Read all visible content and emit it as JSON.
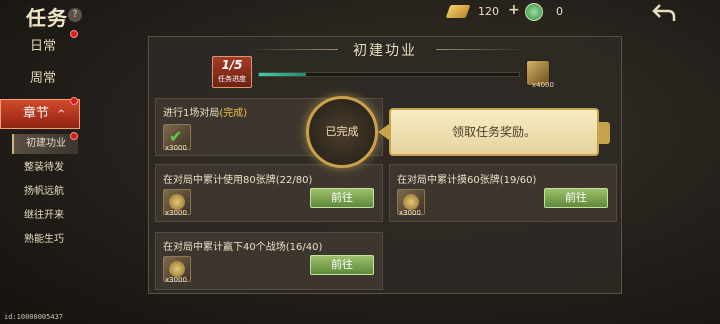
{
  "header": {
    "title": "任务",
    "help": "?",
    "gold_amount": "120",
    "plus": "+",
    "jade_amount": "0",
    "back_icon": "back-arrow-icon"
  },
  "sidebar": {
    "items": [
      {
        "label": "日常",
        "has_dot": true
      },
      {
        "label": "周常",
        "has_dot": false
      }
    ],
    "active": {
      "label": "章节",
      "chevron": "^",
      "has_dot": true
    },
    "subitems": [
      {
        "label": "初建功业",
        "active": true,
        "has_dot": true
      },
      {
        "label": "整装待发"
      },
      {
        "label": "扬帆远航"
      },
      {
        "label": "继往开来"
      },
      {
        "label": "熟能生巧"
      }
    ]
  },
  "panel": {
    "title": "初建功业",
    "progress": {
      "value": "1/5",
      "label": "任务进度",
      "fraction": 0.18
    },
    "chest_amount": "x4000"
  },
  "tasks": [
    {
      "title": "进行1场对局",
      "status": "(完成)",
      "reward": "x3000",
      "completed": true
    },
    {
      "title": "在对局中累计使用80张牌(22/80)",
      "reward": "x3000",
      "button": "前往"
    },
    {
      "title": "在对局中累计摸60张牌(19/60)",
      "reward": "x3000",
      "button": "前往"
    },
    {
      "title": "在对局中累计赢下40个战场(16/40)",
      "reward": "x3000",
      "button": "前往"
    }
  ],
  "completed_stamp": "已完成",
  "tooltip": "领取任务奖励。",
  "footer_id": "id:10000005437",
  "colors": {
    "accent_red": "#d24a2a",
    "go_button": "#7ea65a",
    "progress": "#3fd2a6"
  }
}
